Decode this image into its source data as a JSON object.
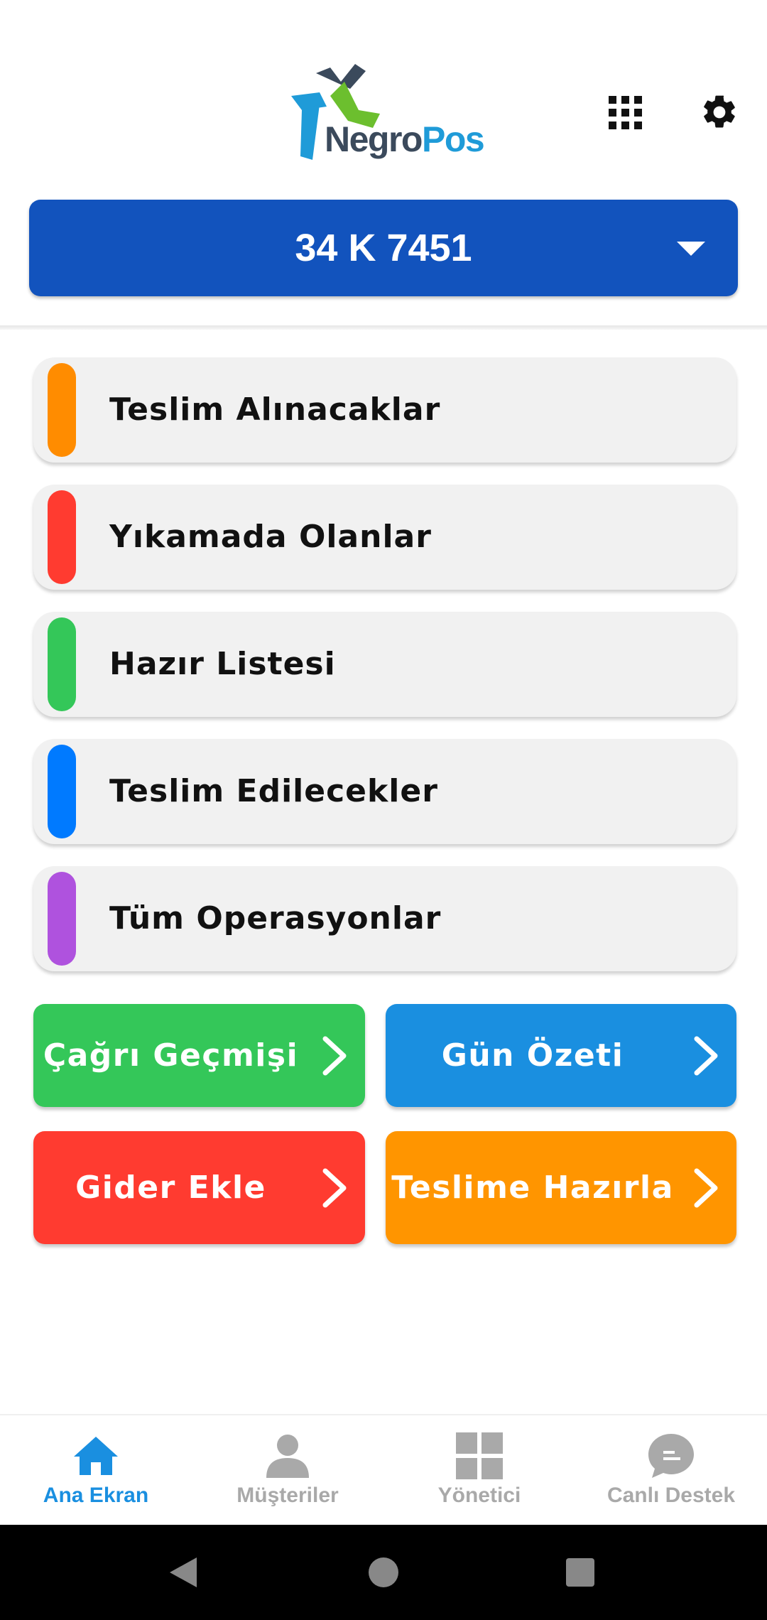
{
  "app": {
    "logo_text_a": "Negro",
    "logo_text_b": "Pos"
  },
  "header": {
    "grid_icon": "grid-icon",
    "settings_icon": "gear-icon"
  },
  "plate": {
    "value": "34 K 7451"
  },
  "status_list": [
    {
      "label": "Teslim Alınacaklar",
      "color": "#ff8c00"
    },
    {
      "label": "Yıkamada Olanlar",
      "color": "#ff3b30"
    },
    {
      "label": "Hazır Listesi",
      "color": "#34c759"
    },
    {
      "label": "Teslim Edilecekler",
      "color": "#007aff"
    },
    {
      "label": "Tüm Operasyonlar",
      "color": "#af52de"
    }
  ],
  "actions": [
    {
      "label": "Çağrı Geçmişi",
      "color": "#34c759"
    },
    {
      "label": "Gün Özeti",
      "color": "#1a8fe0"
    },
    {
      "label": "Gider Ekle",
      "color": "#ff3b30"
    },
    {
      "label": "Teslime Hazırla",
      "color": "#ff9500"
    }
  ],
  "bottom_nav": [
    {
      "label": "Ana Ekran",
      "icon": "home-icon",
      "active": true
    },
    {
      "label": "Müşteriler",
      "icon": "user-icon",
      "active": false
    },
    {
      "label": "Yönetici",
      "icon": "dashboard-icon",
      "active": false
    },
    {
      "label": "Canlı Destek",
      "icon": "chat-icon",
      "active": false
    }
  ],
  "colors": {
    "active": "#1a8fe0",
    "inactive": "#a9a9a9",
    "plate_bg": "#1253bd"
  }
}
